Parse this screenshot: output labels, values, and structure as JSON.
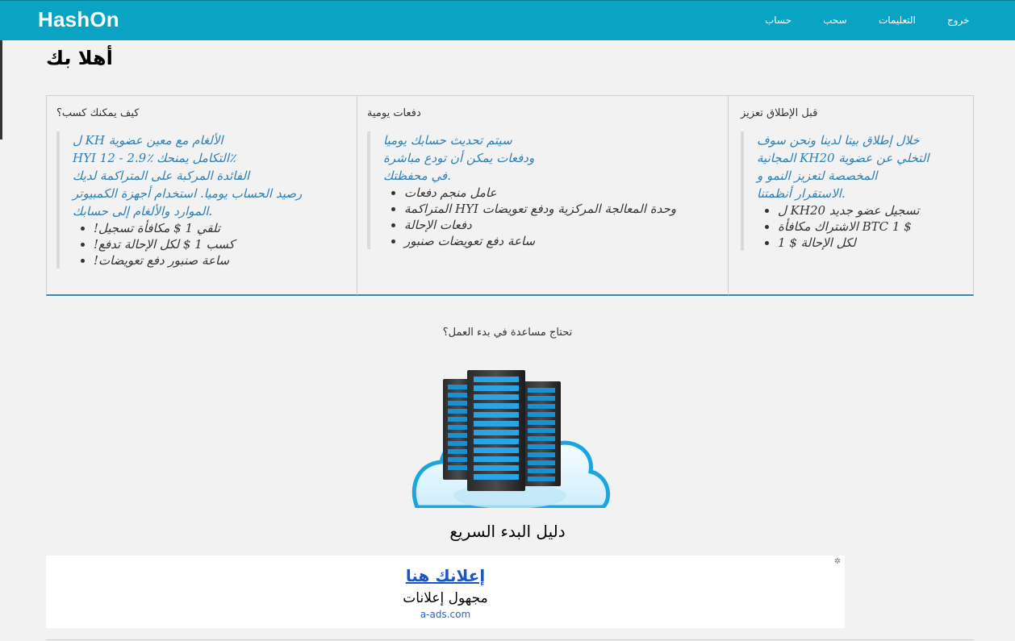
{
  "header": {
    "brand": "HashOn",
    "nav": [
      "خروج",
      "التعليمات",
      "سحب",
      "حساب"
    ]
  },
  "welcome": "أهلا بك",
  "panels": [
    {
      "title": "كيف يمكنك كسب؟",
      "quote_lines": [
        "ل KH الألغام مع معين عضوية",
        "HYI 12 - 2.9٪ التكامل يمنحك٪",
        "الفائدة المركبة على المتراكمة لديك",
        "رصيد الحساب يوميا. استخدام أجهزة الكمبيوتر",
        "الموارد والألغام إلى حسابك."
      ],
      "bullets": [
        "!تلقي 1 $ مكافأة تسجيل",
        "!كسب 1 $ لكل الإحالة تدفع",
        "!ساعة صنبور دفع تعويضات"
      ]
    },
    {
      "title": "دفعات يومية",
      "quote_lines": [
        "سيتم تحديث حسابك يوميا",
        "ودفعات يمكن أن تودع مباشرة",
        "في محفظتك."
      ],
      "bullets": [
        "عامل منجم دفعات",
        "المتراكمة HYI وحدة المعالجة المركزية ودفع تعويضات",
        "دفعات الإحالة",
        "ساعة دفع تعويضات صنبور"
      ]
    },
    {
      "title": "قبل الإطلاق تعزيز",
      "quote_lines": [
        "خلال إطلاق بيتا لدينا ونحن سوف",
        "المجانية KHالتخلي عن عضوية 20",
        "المخصصة لتعزيز النمو و",
        "الاستقرار أنظمتنا."
      ],
      "bullets": [
        "ل KHتسجيل عضو جديد 20",
        "الاشتراك مكافأة BTC 1 $",
        "لكل الإحالة $ 1"
      ]
    }
  ],
  "help_text": "تحتاج مساعدة في بدء العمل؟",
  "guide_title": "دليل البدء السريع",
  "ad": {
    "headline": "إعلانك هنا",
    "subline": "مجهول إعلانات",
    "domain": "a-ads.com"
  },
  "colors": {
    "header_bg": "#0aa3c4",
    "quote_text": "#2f7fb5",
    "ad_link": "#1a57c4"
  }
}
